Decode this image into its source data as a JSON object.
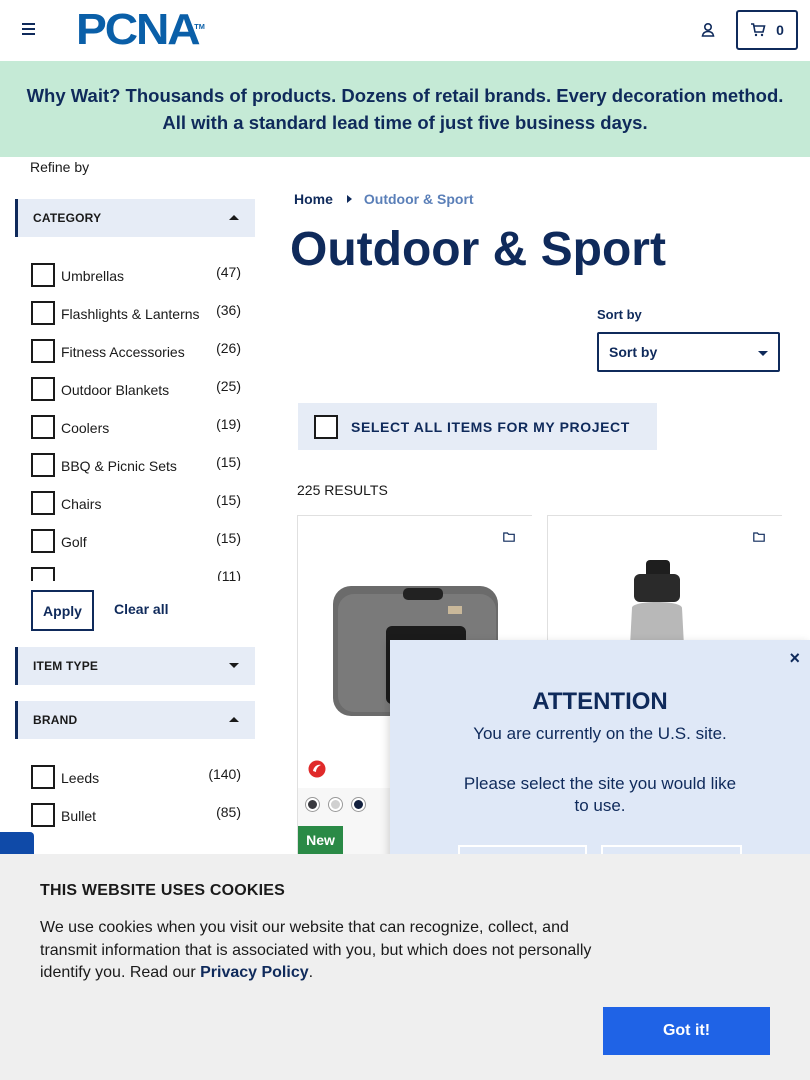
{
  "header": {
    "logo_text": "PCNA",
    "logo_tm": "TM",
    "cart_count": "0"
  },
  "banner": {
    "text": "Why Wait? Thousands of products. Dozens of retail brands. Every decoration method. All with a standard lead time of just five business days."
  },
  "sidebar": {
    "refine_label": "Refine by",
    "category": {
      "title": "CATEGORY",
      "items": [
        {
          "label": "Umbrellas",
          "count": "(47)"
        },
        {
          "label": "Flashlights & Lanterns",
          "count": "(36)"
        },
        {
          "label": "Fitness Accessories",
          "count": "(26)"
        },
        {
          "label": "Outdoor Blankets",
          "count": "(25)"
        },
        {
          "label": "Coolers",
          "count": "(19)"
        },
        {
          "label": "BBQ & Picnic Sets",
          "count": "(15)"
        },
        {
          "label": "Chairs",
          "count": "(15)"
        },
        {
          "label": "Golf",
          "count": "(15)"
        },
        {
          "label": "",
          "count": "(11)"
        }
      ]
    },
    "apply_label": "Apply",
    "clear_label": "Clear all",
    "item_type": {
      "title": "ITEM TYPE"
    },
    "brand": {
      "title": "BRAND",
      "items": [
        {
          "label": "Leeds",
          "count": "(140)"
        },
        {
          "label": "Bullet",
          "count": "(85)"
        }
      ]
    }
  },
  "main": {
    "breadcrumb": {
      "home": "Home",
      "current": "Outdoor & Sport"
    },
    "title": "Outdoor & Sport",
    "sort_label": "Sort by",
    "sort_value": "Sort by",
    "select_all_label": "SELECT ALL ITEMS FOR MY PROJECT",
    "results": "225 RESULTS",
    "products": [
      {
        "badge": "New",
        "swatches": [
          "#3a3a3f",
          "#d0d0d0",
          "#13213f"
        ]
      },
      {
        "badge": ""
      }
    ]
  },
  "modal": {
    "close": "×",
    "title": "ATTENTION",
    "subtitle": "You are currently on the U.S. site.",
    "prompt": "Please select the site you would like to use."
  },
  "cookie": {
    "title": "THIS WEBSITE USES COOKIES",
    "body": "We use cookies when you visit our website that can recognize, collect, and transmit information that is associated with you, but which does not personally identify you. Read our ",
    "link": "Privacy Policy",
    "end": ".",
    "button": "Got it!"
  },
  "colors": {
    "navy": "#0f2a5b",
    "logo_blue": "#0a5fa8",
    "banner_green": "#c5ead6",
    "facet_bg": "#e6ecf6",
    "new_badge": "#2a8a46",
    "cookie_button": "#1f63e6"
  }
}
